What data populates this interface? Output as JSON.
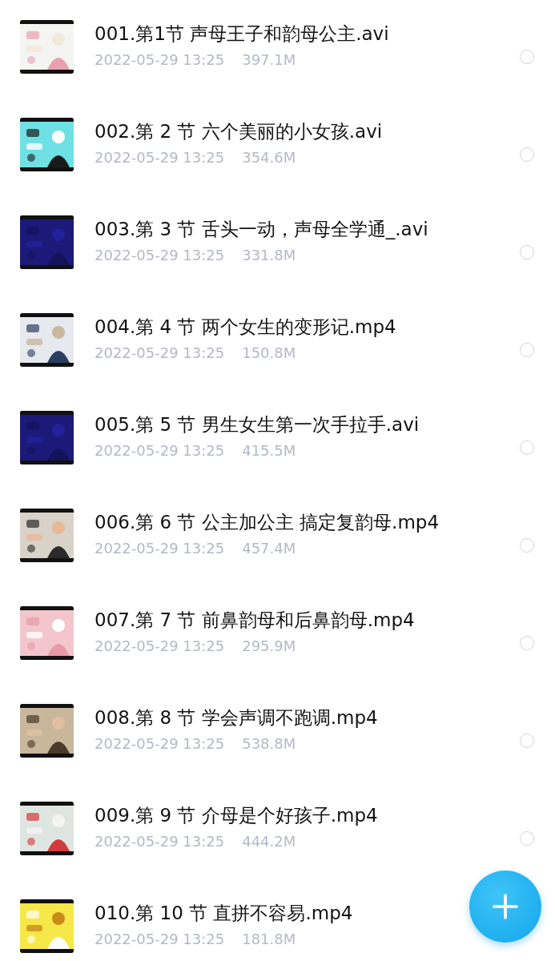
{
  "files": [
    {
      "title": "001.第1节 声母王子和韵母公主.avi",
      "date": "2022-05-29 13:25",
      "size": "397.1M",
      "selected": false
    },
    {
      "title": "002.第 2 节 六个美丽的小女孩.avi",
      "date": "2022-05-29 13:25",
      "size": "354.6M",
      "selected": false
    },
    {
      "title": "003.第 3 节 舌头一动，声母全学通_.avi",
      "date": "2022-05-29 13:25",
      "size": "331.8M",
      "selected": false
    },
    {
      "title": "004.第 4 节 两个女生的变形记.mp4",
      "date": "2022-05-29 13:25",
      "size": "150.8M",
      "selected": false
    },
    {
      "title": "005.第 5 节 男生女生第一次手拉手.avi",
      "date": "2022-05-29 13:25",
      "size": "415.5M",
      "selected": false
    },
    {
      "title": "006.第 6 节 公主加公主 搞定复韵母.mp4",
      "date": "2022-05-29 13:25",
      "size": "457.4M",
      "selected": false
    },
    {
      "title": "007.第 7 节 前鼻韵母和后鼻韵母.mp4",
      "date": "2022-05-29 13:25",
      "size": "295.9M",
      "selected": false
    },
    {
      "title": "008.第 8 节 学会声调不跑调.mp4",
      "date": "2022-05-29 13:25",
      "size": "538.8M",
      "selected": false
    },
    {
      "title": "009.第 9 节 介母是个好孩子.mp4",
      "date": "2022-05-29 13:25",
      "size": "444.2M",
      "selected": false
    },
    {
      "title": "010.第 10 节 直拼不容易.mp4",
      "date": "2022-05-29 13:25",
      "size": "181.8M"
    }
  ]
}
